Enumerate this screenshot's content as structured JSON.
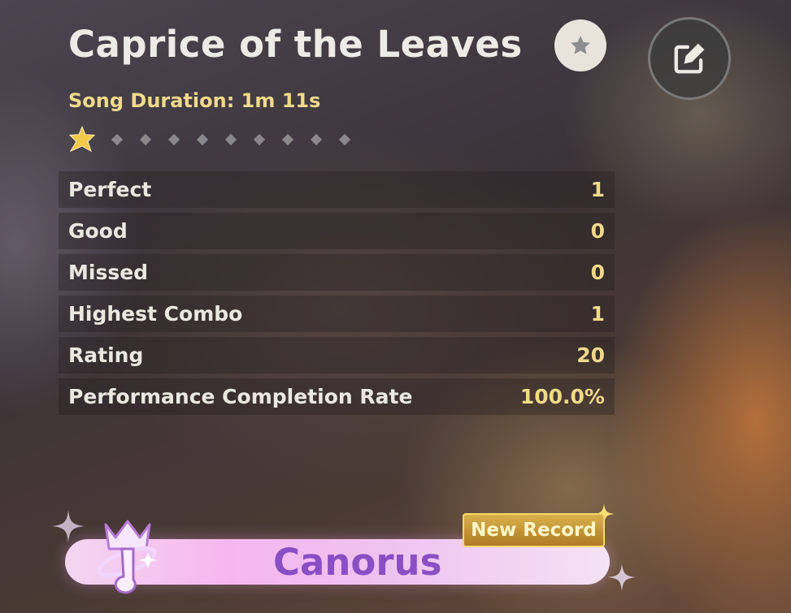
{
  "song": {
    "title": "Caprice of the Leaves",
    "duration_label": "Song Duration: 1m 11s",
    "difficulty_level": 1,
    "difficulty_max": 10
  },
  "stats": [
    {
      "label": "Perfect",
      "value": "1"
    },
    {
      "label": "Good",
      "value": "0"
    },
    {
      "label": "Missed",
      "value": "0"
    },
    {
      "label": "Highest Combo",
      "value": "1"
    },
    {
      "label": "Rating",
      "value": "20"
    },
    {
      "label": "Performance Completion Rate",
      "value": "100.0%"
    }
  ],
  "result": {
    "rank": "Canorus",
    "badge": "New Record"
  },
  "icons": {
    "favorite": "star-icon",
    "edit": "edit-icon",
    "rank": "crown-note-icon"
  },
  "colors": {
    "accent_gold": "#f1da8a",
    "rank_purple": "#8a4fc4"
  }
}
